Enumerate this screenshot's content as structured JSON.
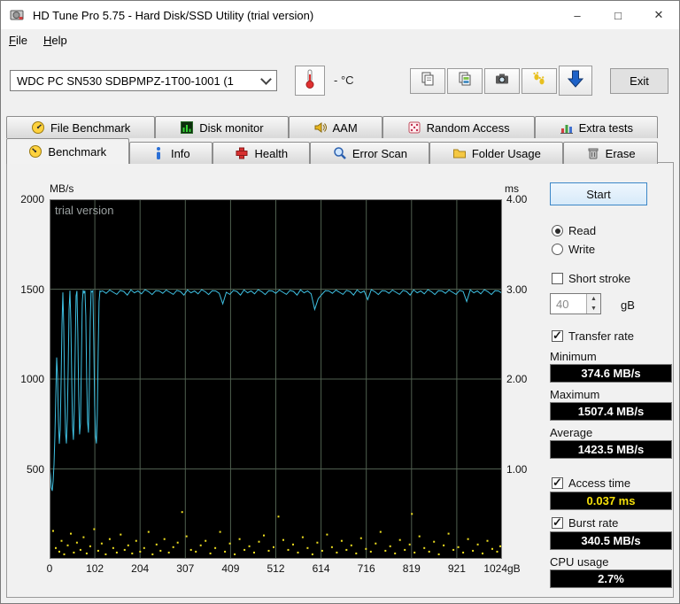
{
  "window": {
    "title": "HD Tune Pro 5.75 - Hard Disk/SSD Utility (trial version)",
    "controls": {
      "minimize": "–",
      "maximize": "□",
      "close": "✕"
    }
  },
  "menu": {
    "items": [
      {
        "label": "File"
      },
      {
        "label": "Help"
      }
    ]
  },
  "toolbar": {
    "drive_selector": {
      "value": "WDC PC SN530 SDBPMPZ-1T00-1001 (1"
    },
    "temperature_value": "-",
    "temperature_unit": "°C",
    "exit_label": "Exit",
    "icons": [
      "thermometer-icon",
      "copy-icon",
      "copy-image-icon",
      "camera-icon",
      "paw-icon",
      "download-icon"
    ]
  },
  "tabs": {
    "row1": [
      {
        "label": "File Benchmark",
        "icon": "file-benchmark-icon"
      },
      {
        "label": "Disk monitor",
        "icon": "disk-monitor-icon"
      },
      {
        "label": "AAM",
        "icon": "aam-icon"
      },
      {
        "label": "Random Access",
        "icon": "random-access-icon"
      },
      {
        "label": "Extra tests",
        "icon": "extra-tests-icon"
      }
    ],
    "row2": [
      {
        "label": "Benchmark",
        "icon": "benchmark-icon",
        "active": true
      },
      {
        "label": "Info",
        "icon": "info-icon"
      },
      {
        "label": "Health",
        "icon": "health-icon"
      },
      {
        "label": "Error Scan",
        "icon": "error-scan-icon"
      },
      {
        "label": "Folder Usage",
        "icon": "folder-usage-icon"
      },
      {
        "label": "Erase",
        "icon": "erase-icon"
      }
    ]
  },
  "side_panel": {
    "start_label": "Start",
    "read_label": "Read",
    "read_selected": true,
    "write_label": "Write",
    "write_selected": false,
    "short_stroke_label": "Short stroke",
    "short_stroke_checked": false,
    "short_stroke_value": "40",
    "short_stroke_unit": "gB",
    "transfer_rate_label": "Transfer rate",
    "transfer_rate_checked": true,
    "minimum_label": "Minimum",
    "minimum_value": "374.6 MB/s",
    "maximum_label": "Maximum",
    "maximum_value": "1507.4 MB/s",
    "average_label": "Average",
    "average_value": "1423.5 MB/s",
    "access_time_label": "Access time",
    "access_time_checked": true,
    "access_time_value": "0.037 ms",
    "burst_rate_label": "Burst rate",
    "burst_rate_checked": true,
    "burst_rate_value": "340.5 MB/s",
    "cpu_usage_label": "CPU usage",
    "cpu_usage_value": "2.7%"
  },
  "chart_data": {
    "type": "line",
    "watermark": "trial version",
    "y_left_label": "MB/s",
    "y_right_label": "ms",
    "y_left_ticks": [
      500,
      1000,
      1500,
      2000
    ],
    "y_right_ticks": [
      "1.00",
      "2.00",
      "3.00",
      "4.00"
    ],
    "x_ticks": [
      "0",
      "102",
      "204",
      "307",
      "409",
      "512",
      "614",
      "716",
      "819",
      "921",
      "1024gB"
    ],
    "x_range": [
      0,
      1024
    ],
    "y_left_range": [
      0,
      2000
    ],
    "y_right_range": [
      0,
      4
    ],
    "grid": true,
    "bg_color": "#000000",
    "grid_color": "#4f5f4f",
    "series": [
      {
        "name": "Transfer rate",
        "axis": "left",
        "unit": "MB/s",
        "color": "#3fc1e3",
        "points": [
          [
            0,
            510
          ],
          [
            2,
            468
          ],
          [
            4,
            396
          ],
          [
            6,
            378
          ],
          [
            8,
            432
          ],
          [
            10,
            524
          ],
          [
            12,
            685
          ],
          [
            14,
            905
          ],
          [
            16,
            1120
          ],
          [
            18,
            1015
          ],
          [
            20,
            762
          ],
          [
            22,
            640
          ],
          [
            24,
            718
          ],
          [
            26,
            985
          ],
          [
            28,
            1305
          ],
          [
            30,
            1482
          ],
          [
            32,
            1290
          ],
          [
            34,
            948
          ],
          [
            36,
            702
          ],
          [
            38,
            642
          ],
          [
            40,
            780
          ],
          [
            42,
            1052
          ],
          [
            44,
            1385
          ],
          [
            46,
            1492
          ],
          [
            48,
            1322
          ],
          [
            50,
            1002
          ],
          [
            52,
            742
          ],
          [
            54,
            662
          ],
          [
            56,
            822
          ],
          [
            58,
            1152
          ],
          [
            60,
            1462
          ],
          [
            62,
            1490
          ],
          [
            64,
            1252
          ],
          [
            66,
            902
          ],
          [
            68,
            692
          ],
          [
            70,
            752
          ],
          [
            72,
            1082
          ],
          [
            74,
            1422
          ],
          [
            76,
            1494
          ],
          [
            78,
            1480
          ],
          [
            80,
            1491
          ],
          [
            82,
            1352
          ],
          [
            84,
            1002
          ],
          [
            86,
            762
          ],
          [
            88,
            702
          ],
          [
            90,
            952
          ],
          [
            92,
            1322
          ],
          [
            94,
            1490
          ],
          [
            96,
            1484
          ],
          [
            98,
            1491
          ],
          [
            100,
            1202
          ],
          [
            102,
            852
          ],
          [
            104,
            682
          ],
          [
            106,
            642
          ],
          [
            108,
            802
          ],
          [
            110,
            1152
          ],
          [
            112,
            1432
          ],
          [
            114,
            1490
          ],
          [
            116,
            1486
          ],
          [
            118,
            1489
          ],
          [
            120,
            1490
          ],
          [
            128,
            1477
          ],
          [
            136,
            1495
          ],
          [
            144,
            1483
          ],
          [
            152,
            1471
          ],
          [
            160,
            1493
          ],
          [
            168,
            1487
          ],
          [
            176,
            1467
          ],
          [
            184,
            1496
          ],
          [
            192,
            1480
          ],
          [
            200,
            1490
          ],
          [
            208,
            1474
          ],
          [
            216,
            1497
          ],
          [
            224,
            1486
          ],
          [
            232,
            1470
          ],
          [
            240,
            1491
          ],
          [
            248,
            1490
          ],
          [
            256,
            1477
          ],
          [
            264,
            1495
          ],
          [
            272,
            1483
          ],
          [
            280,
            1471
          ],
          [
            288,
            1493
          ],
          [
            296,
            1487
          ],
          [
            304,
            1467
          ],
          [
            312,
            1496
          ],
          [
            320,
            1480
          ],
          [
            328,
            1490
          ],
          [
            336,
            1474
          ],
          [
            344,
            1497
          ],
          [
            352,
            1486
          ],
          [
            360,
            1470
          ],
          [
            368,
            1491
          ],
          [
            376,
            1490
          ],
          [
            384,
            1477
          ],
          [
            392,
            1418
          ],
          [
            400,
            1483
          ],
          [
            408,
            1471
          ],
          [
            416,
            1493
          ],
          [
            424,
            1487
          ],
          [
            432,
            1467
          ],
          [
            440,
            1496
          ],
          [
            448,
            1480
          ],
          [
            456,
            1490
          ],
          [
            464,
            1474
          ],
          [
            472,
            1497
          ],
          [
            480,
            1486
          ],
          [
            488,
            1470
          ],
          [
            496,
            1491
          ],
          [
            504,
            1490
          ],
          [
            512,
            1477
          ],
          [
            520,
            1495
          ],
          [
            528,
            1483
          ],
          [
            536,
            1471
          ],
          [
            544,
            1493
          ],
          [
            552,
            1487
          ],
          [
            560,
            1467
          ],
          [
            568,
            1496
          ],
          [
            576,
            1480
          ],
          [
            584,
            1490
          ],
          [
            592,
            1474
          ],
          [
            600,
            1387
          ],
          [
            608,
            1447
          ],
          [
            616,
            1470
          ],
          [
            624,
            1491
          ],
          [
            632,
            1490
          ],
          [
            640,
            1477
          ],
          [
            648,
            1495
          ],
          [
            656,
            1483
          ],
          [
            664,
            1471
          ],
          [
            672,
            1493
          ],
          [
            680,
            1487
          ],
          [
            688,
            1467
          ],
          [
            696,
            1496
          ],
          [
            704,
            1480
          ],
          [
            712,
            1490
          ],
          [
            720,
            1442
          ],
          [
            728,
            1497
          ],
          [
            736,
            1486
          ],
          [
            744,
            1470
          ],
          [
            752,
            1491
          ],
          [
            760,
            1490
          ],
          [
            768,
            1477
          ],
          [
            776,
            1495
          ],
          [
            784,
            1483
          ],
          [
            792,
            1471
          ],
          [
            800,
            1493
          ],
          [
            808,
            1487
          ],
          [
            816,
            1467
          ],
          [
            824,
            1496
          ],
          [
            832,
            1480
          ],
          [
            840,
            1490
          ],
          [
            848,
            1474
          ],
          [
            856,
            1497
          ],
          [
            864,
            1486
          ],
          [
            872,
            1470
          ],
          [
            880,
            1491
          ],
          [
            888,
            1490
          ],
          [
            896,
            1477
          ],
          [
            904,
            1495
          ],
          [
            912,
            1483
          ],
          [
            920,
            1471
          ],
          [
            928,
            1493
          ],
          [
            936,
            1487
          ],
          [
            944,
            1431
          ],
          [
            952,
            1496
          ],
          [
            960,
            1480
          ],
          [
            968,
            1490
          ],
          [
            976,
            1474
          ],
          [
            984,
            1497
          ],
          [
            992,
            1486
          ],
          [
            1000,
            1470
          ],
          [
            1008,
            1491
          ],
          [
            1016,
            1490
          ],
          [
            1024,
            1477
          ]
        ]
      },
      {
        "name": "Access time",
        "axis": "right",
        "unit": "ms",
        "type": "scatter",
        "color": "#f0e020",
        "points": [
          [
            8,
            0.31
          ],
          [
            14,
            0.12
          ],
          [
            22,
            0.08
          ],
          [
            27,
            0.2
          ],
          [
            33,
            0.05
          ],
          [
            41,
            0.15
          ],
          [
            48,
            0.28
          ],
          [
            55,
            0.07
          ],
          [
            62,
            0.18
          ],
          [
            70,
            0.1
          ],
          [
            77,
            0.24
          ],
          [
            84,
            0.06
          ],
          [
            92,
            0.14
          ],
          [
            101,
            0.33
          ],
          [
            110,
            0.09
          ],
          [
            118,
            0.17
          ],
          [
            127,
            0.05
          ],
          [
            136,
            0.22
          ],
          [
            144,
            0.12
          ],
          [
            152,
            0.07
          ],
          [
            161,
            0.27
          ],
          [
            170,
            0.1
          ],
          [
            178,
            0.15
          ],
          [
            187,
            0.06
          ],
          [
            196,
            0.2
          ],
          [
            205,
            0.08
          ],
          [
            214,
            0.12
          ],
          [
            224,
            0.3
          ],
          [
            233,
            0.05
          ],
          [
            242,
            0.16
          ],
          [
            251,
            0.09
          ],
          [
            260,
            0.22
          ],
          [
            270,
            0.07
          ],
          [
            280,
            0.13
          ],
          [
            290,
            0.18
          ],
          [
            300,
            0.52
          ],
          [
            310,
            0.25
          ],
          [
            320,
            0.1
          ],
          [
            331,
            0.08
          ],
          [
            342,
            0.15
          ],
          [
            353,
            0.2
          ],
          [
            364,
            0.06
          ],
          [
            375,
            0.12
          ],
          [
            386,
            0.3
          ],
          [
            397,
            0.08
          ],
          [
            408,
            0.17
          ],
          [
            419,
            0.05
          ],
          [
            430,
            0.22
          ],
          [
            441,
            0.1
          ],
          [
            452,
            0.14
          ],
          [
            463,
            0.07
          ],
          [
            474,
            0.19
          ],
          [
            485,
            0.26
          ],
          [
            496,
            0.09
          ],
          [
            507,
            0.13
          ],
          [
            518,
            0.47
          ],
          [
            529,
            0.21
          ],
          [
            540,
            0.1
          ],
          [
            551,
            0.16
          ],
          [
            562,
            0.07
          ],
          [
            573,
            0.24
          ],
          [
            584,
            0.12
          ],
          [
            595,
            0.05
          ],
          [
            606,
            0.18
          ],
          [
            617,
            0.09
          ],
          [
            628,
            0.27
          ],
          [
            639,
            0.13
          ],
          [
            650,
            0.07
          ],
          [
            661,
            0.2
          ],
          [
            672,
            0.1
          ],
          [
            683,
            0.15
          ],
          [
            694,
            0.06
          ],
          [
            705,
            0.23
          ],
          [
            716,
            0.11
          ],
          [
            727,
            0.08
          ],
          [
            738,
            0.17
          ],
          [
            749,
            0.3
          ],
          [
            760,
            0.09
          ],
          [
            771,
            0.14
          ],
          [
            782,
            0.06
          ],
          [
            793,
            0.21
          ],
          [
            804,
            0.1
          ],
          [
            815,
            0.16
          ],
          [
            820,
            0.5
          ],
          [
            826,
            0.07
          ],
          [
            837,
            0.25
          ],
          [
            848,
            0.12
          ],
          [
            859,
            0.08
          ],
          [
            870,
            0.19
          ],
          [
            881,
            0.05
          ],
          [
            892,
            0.15
          ],
          [
            903,
            0.28
          ],
          [
            914,
            0.1
          ],
          [
            925,
            0.13
          ],
          [
            936,
            0.07
          ],
          [
            947,
            0.22
          ],
          [
            958,
            0.09
          ],
          [
            969,
            0.16
          ],
          [
            980,
            0.06
          ],
          [
            991,
            0.2
          ],
          [
            1002,
            0.11
          ],
          [
            1013,
            0.08
          ],
          [
            1020,
            0.14
          ]
        ]
      }
    ]
  }
}
